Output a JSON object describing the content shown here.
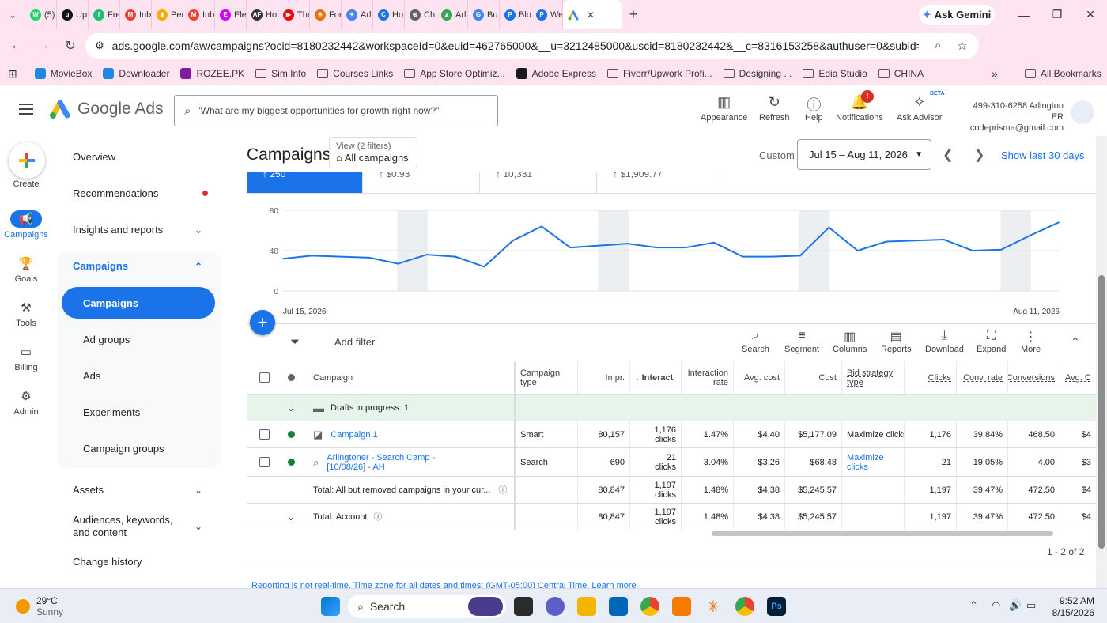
{
  "browser": {
    "tabs": [
      {
        "label": "(5)",
        "color": "#25d366",
        "glyph": "W"
      },
      {
        "label": "Up",
        "color": "#111111",
        "glyph": "u"
      },
      {
        "label": "Fre",
        "color": "#1dbf73",
        "glyph": "f"
      },
      {
        "label": "Inb",
        "color": "#ea4335",
        "glyph": "M"
      },
      {
        "label": "Per",
        "color": "#f9ab00",
        "glyph": "▮"
      },
      {
        "label": "Inb",
        "color": "#ea4335",
        "glyph": "M"
      },
      {
        "label": "Ele",
        "color": "#d500f9",
        "glyph": "E"
      },
      {
        "label": "Ho",
        "color": "#333333",
        "glyph": "AF"
      },
      {
        "label": "The",
        "color": "#ff0000",
        "glyph": "▶"
      },
      {
        "label": "For",
        "color": "#e8710a",
        "glyph": "✳"
      },
      {
        "label": "Arl",
        "color": "#4285f4",
        "glyph": "✦"
      },
      {
        "label": "Ho",
        "color": "#1a73e8",
        "glyph": "C"
      },
      {
        "label": "Ch",
        "color": "#5f6368",
        "glyph": "⊛"
      },
      {
        "label": "Arl",
        "color": "#34a853",
        "glyph": "▲"
      },
      {
        "label": "Bu",
        "color": "#4285f4",
        "glyph": "G"
      },
      {
        "label": "Blo",
        "color": "#1a73e8",
        "glyph": "P"
      },
      {
        "label": "We",
        "color": "#1a73e8",
        "glyph": "P"
      }
    ],
    "active_tab_close": "✕",
    "new_tab": "+",
    "gemini_label": "Ask Gemini",
    "url": "ads.google.com/aw/campaigns?ocid=8180232442&workspaceId=0&euid=462765000&__u=3212485000&uscid=8180232442&__c=8316153258&authuser=0&subid=all-en-awhp-g...",
    "bookmarks": [
      {
        "label": "MovieBox",
        "kind": "play"
      },
      {
        "label": "Downloader",
        "kind": "play"
      },
      {
        "label": "ROZEE.PK",
        "kind": "rozee"
      },
      {
        "label": "Sim Info",
        "kind": "folder"
      },
      {
        "label": "Courses Links",
        "kind": "folder"
      },
      {
        "label": "App Store Optimiz...",
        "kind": "folder"
      },
      {
        "label": "Adobe Express",
        "kind": "adobe"
      },
      {
        "label": "Fiverr/Upwork Profi...",
        "kind": "folder"
      },
      {
        "label": "Designing . .",
        "kind": "folder"
      },
      {
        "label": "Edia Studio",
        "kind": "folder"
      },
      {
        "label": "CHINA",
        "kind": "folder"
      }
    ],
    "bookmarks_more": "»",
    "all_bookmarks": "All Bookmarks"
  },
  "header": {
    "product": "Google Ads",
    "search_placeholder": "\"What are my biggest opportunities for growth right now?\"",
    "appearance": "Appearance",
    "refresh": "Refresh",
    "help": "Help",
    "notifications": "Notifications",
    "notif_badge": "!",
    "ask_advisor": "Ask Advisor",
    "beta": "BETA",
    "account_line1": "499-310-6258 Arlington ER",
    "account_line2": "codeprisma@gmail.com"
  },
  "rail": {
    "create": "Create",
    "campaigns": "Campaigns",
    "goals": "Goals",
    "tools": "Tools",
    "billing": "Billing",
    "admin": "Admin"
  },
  "sidenav": {
    "overview": "Overview",
    "recommendations": "Recommendations",
    "insights": "Insights and reports",
    "campaigns_group": "Campaigns",
    "campaigns": "Campaigns",
    "ad_groups": "Ad groups",
    "ads": "Ads",
    "experiments": "Experiments",
    "campaign_groups": "Campaign groups",
    "assets": "Assets",
    "audiences": "Audiences, keywords, and content",
    "change_history": "Change history"
  },
  "main": {
    "title": "Campaigns",
    "view_label": "View (2 filters)",
    "view_value": "All campaigns",
    "custom": "Custom",
    "date_range": "Jul 15 – Aug 11, 2026",
    "show_last": "Show last 30 days",
    "scorecards": [
      "250",
      "$0.93",
      "10,331",
      "$1,909.77"
    ],
    "add_filter": "Add filter",
    "tools": {
      "search": "Search",
      "segment": "Segment",
      "columns": "Columns",
      "reports": "Reports",
      "download": "Download",
      "expand": "Expand",
      "more": "More"
    },
    "pager": "1 - 2 of 2",
    "footer_text": "Reporting is not real-time. Time zone for all dates and times: (GMT-05:00) Central Time. ",
    "learn_more": "Learn more"
  },
  "chart_data": {
    "type": "line",
    "x_start_label": "Jul 15, 2026",
    "x_end_label": "Aug 11, 2026",
    "y_ticks": [
      0,
      40,
      80
    ],
    "ylim": [
      0,
      80
    ],
    "grid": true,
    "color": "#1a73e8",
    "values": [
      32,
      35,
      34,
      33,
      27,
      36,
      34,
      24,
      50,
      64,
      43,
      45,
      47,
      43,
      43,
      48,
      34,
      34,
      35,
      63,
      40,
      49,
      50,
      51,
      40,
      41,
      55,
      68
    ],
    "weekend_bands": [
      [
        4,
        5
      ],
      [
        11,
        12
      ],
      [
        18,
        19
      ],
      [
        25,
        26
      ]
    ]
  },
  "table": {
    "headers": {
      "campaign": "Campaign",
      "type": "Campaign type",
      "impr": "Impr.",
      "interactions": "Interact",
      "interaction_rate": "Interaction rate",
      "avg_cost": "Avg. cost",
      "cost": "Cost",
      "bid": "Bid strategy type",
      "clicks": "Clicks",
      "conv_rate": "Conv. rate",
      "conversions": "Conversions",
      "avg_cpc": "Avg. C"
    },
    "drafts": "Drafts in progress: 1",
    "rows": [
      {
        "name": "Campaign 1",
        "type": "Smart",
        "impr": "80,157",
        "inter": "1,176",
        "inter_unit": "clicks",
        "rate": "1.47%",
        "avg": "$4.40",
        "cost": "$5,177.09",
        "bid": "Maximize clicks",
        "clicks": "1,176",
        "conv_rate": "39.84%",
        "conv": "468.50",
        "avgc": "$4"
      },
      {
        "name": "Arlingtoner - Search Camp - [10/08/26] - AH",
        "type": "Search",
        "impr": "690",
        "inter": "21",
        "inter_unit": "clicks",
        "rate": "3.04%",
        "avg": "$3.26",
        "cost": "$68.48",
        "bid": "Maximize clicks",
        "clicks": "21",
        "conv_rate": "19.05%",
        "conv": "4.00",
        "avgc": "$3"
      }
    ],
    "total_removed": {
      "label": "Total: All but removed campaigns in your cur...",
      "impr": "80,847",
      "inter": "1,197",
      "inter_unit": "clicks",
      "rate": "1.48%",
      "avg": "$4.38",
      "cost": "$5,245.57",
      "clicks": "1,197",
      "conv_rate": "39.47%",
      "conv": "472.50",
      "avgc": "$4"
    },
    "total_account": {
      "label": "Total: Account",
      "impr": "80,847",
      "inter": "1,197",
      "inter_unit": "clicks",
      "rate": "1.48%",
      "avg": "$4.38",
      "cost": "$5,245.57",
      "clicks": "1,197",
      "conv_rate": "39.47%",
      "conv": "472.50",
      "avgc": "$4"
    }
  },
  "taskbar": {
    "temp": "29°C",
    "weather": "Sunny",
    "search": "Search",
    "time": "9:52 AM",
    "date": "8/15/2026"
  }
}
